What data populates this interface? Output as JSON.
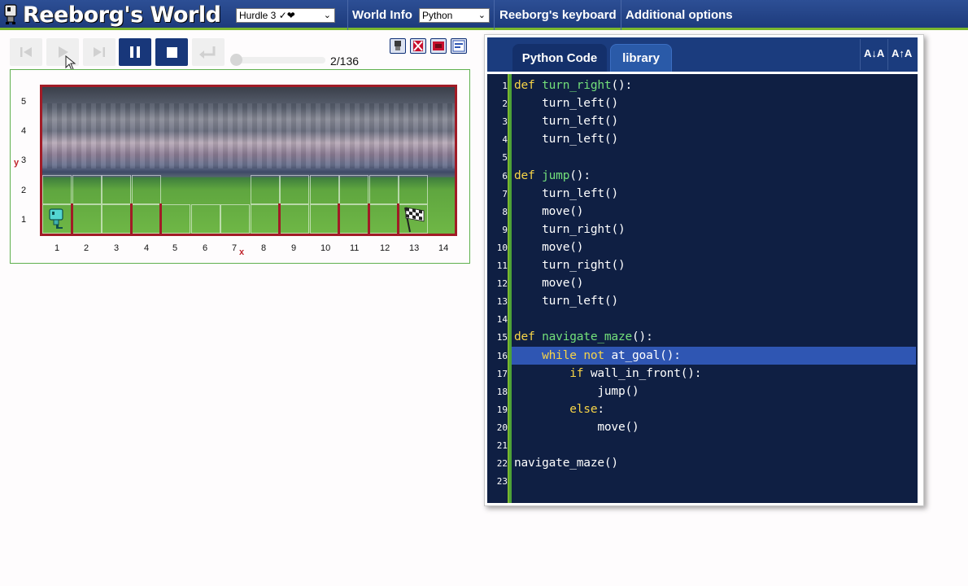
{
  "header": {
    "title": "Reeborg's World",
    "world_select": "Hurdle 3 ✓❤",
    "world_info": "World Info",
    "language_select": "Python",
    "keyboard": "Reeborg's keyboard",
    "options": "Additional options"
  },
  "controls": {
    "step_counter": "2/136",
    "step_current": 2,
    "step_total": 136
  },
  "world": {
    "y_ticks": [
      "5",
      "4",
      "3",
      "2",
      "1"
    ],
    "x_ticks": [
      "1",
      "2",
      "3",
      "4",
      "5",
      "6",
      "7",
      "8",
      "9",
      "10",
      "11",
      "12",
      "13",
      "14"
    ],
    "y_letter": "y",
    "x_letter": "x"
  },
  "editor": {
    "tab_code": "Python Code",
    "tab_library": "library",
    "font_decrease": "A↓A",
    "font_increase": "A↑A",
    "highlighted_line": 16,
    "lines": [
      "def turn_right():",
      "    turn_left()",
      "    turn_left()",
      "    turn_left()",
      "",
      "def jump():",
      "    turn_left()",
      "    move()",
      "    turn_right()",
      "    move()",
      "    turn_right()",
      "    move()",
      "    turn_left()",
      "",
      "def navigate_maze():",
      "    while not at_goal():",
      "        if wall_in_front():",
      "            jump()",
      "        else:",
      "            move()",
      "",
      "navigate_maze()",
      ""
    ]
  },
  "colors": {
    "header_bg": "#1d3b7c",
    "accent_green": "#7ab72e",
    "wall_red": "#a11b26",
    "editor_bg": "#0f1f43",
    "keyword": "#f7d447",
    "function": "#73e07a"
  }
}
